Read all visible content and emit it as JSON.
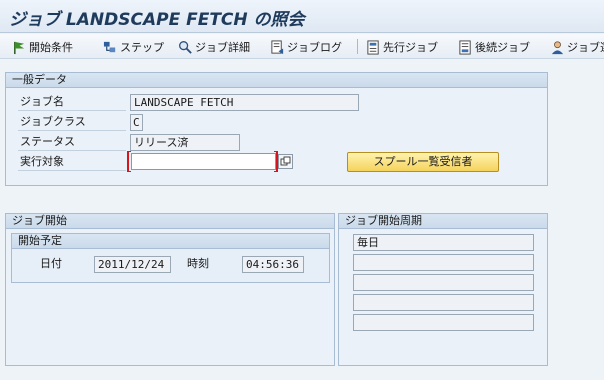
{
  "window": {
    "title": "ジョブ LANDSCAPE FETCH の照会"
  },
  "toolbar": {
    "items": [
      {
        "label": "開始条件",
        "icon": "flag-icon"
      },
      {
        "label": "ステップ",
        "icon": "steps-icon"
      },
      {
        "label": "ジョブ詳細",
        "icon": "job-details-icon"
      },
      {
        "label": "ジョブログ",
        "icon": "job-log-icon"
      },
      {
        "label": "先行ジョブ",
        "icon": "predecessor-job-icon"
      },
      {
        "label": "後続ジョブ",
        "icon": "successor-job-icon"
      },
      {
        "label": "ジョブ選",
        "icon": "job-select-icon"
      }
    ]
  },
  "general": {
    "header": "一般データ",
    "job_name_label": "ジョブ名",
    "job_name_value": "LANDSCAPE FETCH",
    "job_class_label": "ジョブクラス",
    "job_class_value": "C",
    "status_label": "ステータス",
    "status_value": "リリース済",
    "exec_target_label": "実行対象",
    "exec_target_value": "",
    "spool_button": "スプール一覧受信者"
  },
  "job_start": {
    "header": "ジョブ開始",
    "planned_header": "開始予定",
    "date_label": "日付",
    "date_value": "2011/12/24",
    "time_label": "時刻",
    "time_value": "04:56:36"
  },
  "job_period": {
    "header": "ジョブ開始周期",
    "rows": [
      "毎日",
      "",
      "",
      "",
      ""
    ]
  },
  "colors": {
    "title_text": "#1f3b5c",
    "required_marker": "#d8141c",
    "action_button": "#f5d35c",
    "panel_bg": "#eaf1f8"
  }
}
